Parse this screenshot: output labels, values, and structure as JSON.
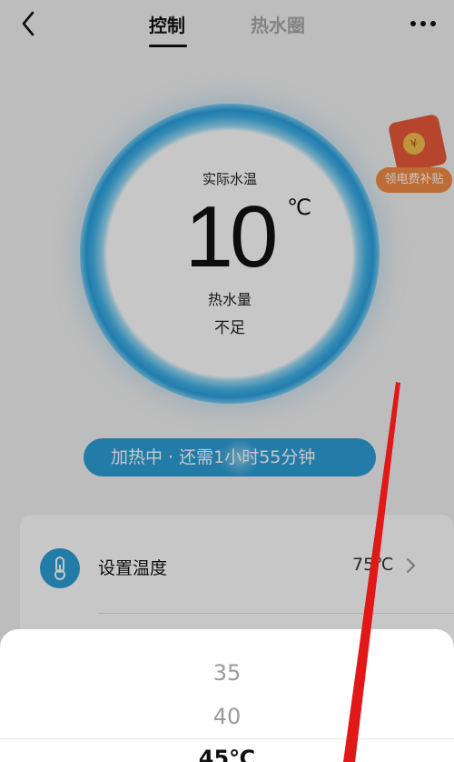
{
  "header": {
    "tabs": [
      {
        "label": "控制",
        "active": true
      },
      {
        "label": "热水圈",
        "active": false
      }
    ]
  },
  "status_ring": {
    "temp_label": "实际水温",
    "temp_value": "10",
    "temp_unit": "℃",
    "volume_label": "热水量",
    "volume_value": "不足"
  },
  "promo": {
    "coin_symbol": "¥",
    "label": "领电费补贴"
  },
  "heating_status": "加热中 · 还需1小时55分钟",
  "settings": {
    "set_temp_label": "设置温度",
    "set_temp_value": "75℃"
  },
  "picker": {
    "options": [
      "35",
      "40"
    ],
    "selected": "45℃"
  },
  "colors": {
    "accent": "#2e9fd8",
    "promo": "#f28b45",
    "annotation": "#e01818"
  },
  "icons": [
    "back-arrow-icon",
    "more-dots-icon",
    "thermometer-icon",
    "chevron-right-icon"
  ]
}
